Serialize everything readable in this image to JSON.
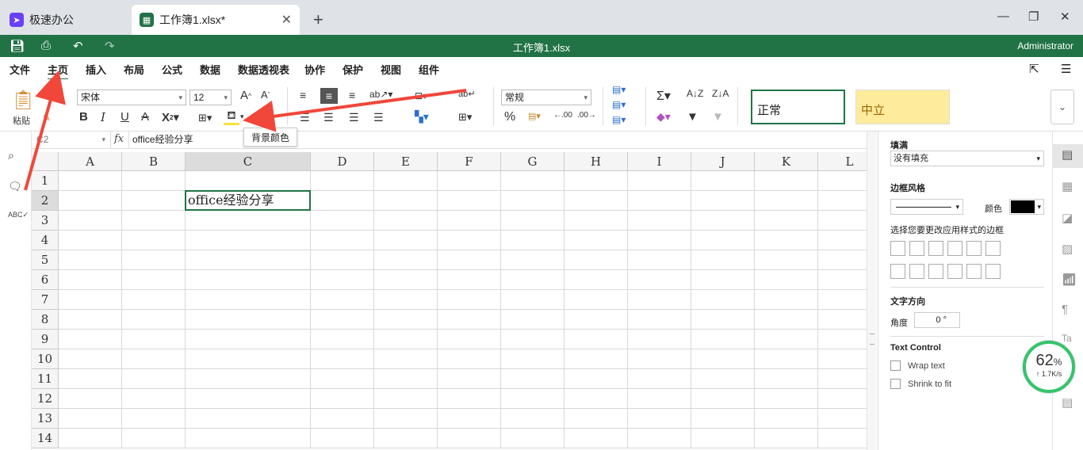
{
  "tabs": [
    {
      "label": "极速办公",
      "icon": "rocket-icon",
      "icon_color": "#6a3ff5"
    },
    {
      "label": "工作簿1.xlsx*",
      "icon": "spreadsheet-icon",
      "icon_color": "#217346",
      "close": "✕"
    }
  ],
  "window": {
    "new_tab": "+",
    "minimize": "—",
    "maximize": "❐",
    "close": "✕"
  },
  "titlebar": {
    "document": "工作簿1.xlsx",
    "user": "Administrator"
  },
  "menu": [
    "文件",
    "主页",
    "插入",
    "布局",
    "公式",
    "数据",
    "数据透视表",
    "协作",
    "保护",
    "视图",
    "组件"
  ],
  "menu_active": "主页",
  "ribbon": {
    "paste_label": "粘贴",
    "font_name": "宋体",
    "font_size": "12",
    "number_format": "常规",
    "tooltip": "背景颜色",
    "styles": {
      "normal": "正常",
      "neutral": "中立"
    }
  },
  "formula_bar": {
    "cell_ref": "C2",
    "fx": "fx",
    "content": "office经验分享"
  },
  "sheet": {
    "columns": [
      "A",
      "B",
      "C",
      "D",
      "E",
      "F",
      "G",
      "H",
      "I",
      "J",
      "K",
      "L"
    ],
    "rows": [
      "1",
      "2",
      "3",
      "4",
      "5",
      "6",
      "7",
      "8",
      "9",
      "10",
      "11",
      "12",
      "13",
      "14"
    ],
    "active_cell": {
      "column": "C",
      "row": "2",
      "text": "office经验分享"
    }
  },
  "panel": {
    "fill_label": "填满",
    "fill_value": "没有填充",
    "border_style_label": "边框风格",
    "color_label": "颜色",
    "border_color": "#000000",
    "border_hint": "选择您要更改应用样式的边框",
    "text_direction_label": "文字方向",
    "angle_label": "角度",
    "angle_value": "0 °",
    "text_control_label": "Text Control",
    "wrap_text": "Wrap text",
    "shrink_to_fit": "Shrink to fit"
  },
  "speed": {
    "percent": "62",
    "unit": "%",
    "rate": "↑ 1.7K/s"
  },
  "colors": {
    "brand": "#217346",
    "arrow": "#f0473a",
    "neutral_fill": "#ffeb9c"
  }
}
